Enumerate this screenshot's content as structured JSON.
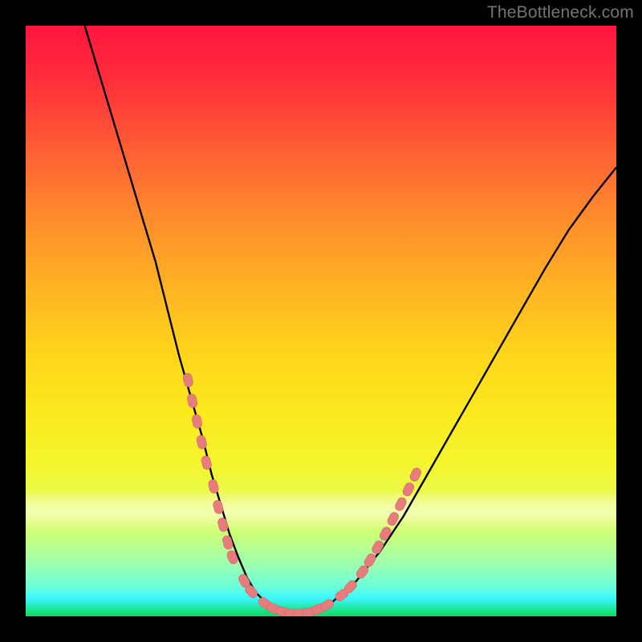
{
  "watermark": {
    "text": "TheBottleneck.com"
  },
  "colors": {
    "frame": "#000000",
    "curve": "#000000",
    "marker_fill": "#e77c7c",
    "marker_stroke": "#cd6b6b"
  },
  "chart_data": {
    "type": "line",
    "title": "",
    "xlabel": "",
    "ylabel": "",
    "xlim": [
      0,
      100
    ],
    "ylim": [
      0,
      100
    ],
    "grid": false,
    "legend": false,
    "axes_visible": false,
    "notes": "V-shaped bottleneck curve over vertical rainbow gradient (top=high bottleneck, bottom=low). No numeric axes shown; values estimated from pixel positions. y=0 at bottom (green), y=100 at top (red).",
    "series": [
      {
        "name": "bottleneck-curve",
        "x": [
          10,
          13,
          16,
          19,
          22,
          24,
          26,
          28,
          30,
          31.5,
          33,
          34.5,
          36,
          37.5,
          39,
          41,
          43,
          45,
          48,
          52,
          56,
          60,
          64,
          68,
          72,
          76,
          80,
          84,
          88,
          92,
          96,
          100
        ],
        "y": [
          100,
          90,
          80,
          70,
          60,
          52,
          44,
          37,
          30,
          24,
          19,
          14,
          10,
          6.5,
          4,
          2,
          1,
          0.5,
          0.8,
          2.5,
          6,
          11,
          17,
          24,
          31,
          38,
          45,
          52,
          59,
          65.5,
          71,
          76
        ]
      }
    ],
    "markers": {
      "name": "highlight-dots",
      "style": "rounded-capsule",
      "color": "#e77c7c",
      "points_xy": [
        [
          27.5,
          40
        ],
        [
          28.2,
          36.5
        ],
        [
          29,
          33
        ],
        [
          29.8,
          29.5
        ],
        [
          30.6,
          26
        ],
        [
          31.8,
          22
        ],
        [
          32.6,
          18.5
        ],
        [
          33.4,
          15.5
        ],
        [
          34.2,
          12.5
        ],
        [
          35,
          10
        ],
        [
          37,
          6
        ],
        [
          38.2,
          4.2
        ],
        [
          40.5,
          2.2
        ],
        [
          42,
          1.3
        ],
        [
          43.5,
          0.8
        ],
        [
          45,
          0.5
        ],
        [
          46.5,
          0.5
        ],
        [
          48,
          0.7
        ],
        [
          49.5,
          1.2
        ],
        [
          51,
          1.9
        ],
        [
          53.5,
          3.6
        ],
        [
          55,
          5
        ],
        [
          57,
          7.5
        ],
        [
          58.3,
          9.5
        ],
        [
          59.6,
          11.7
        ],
        [
          60.9,
          14
        ],
        [
          62.2,
          16.5
        ],
        [
          63.5,
          19
        ],
        [
          64.8,
          21.5
        ],
        [
          66,
          24
        ]
      ]
    }
  }
}
